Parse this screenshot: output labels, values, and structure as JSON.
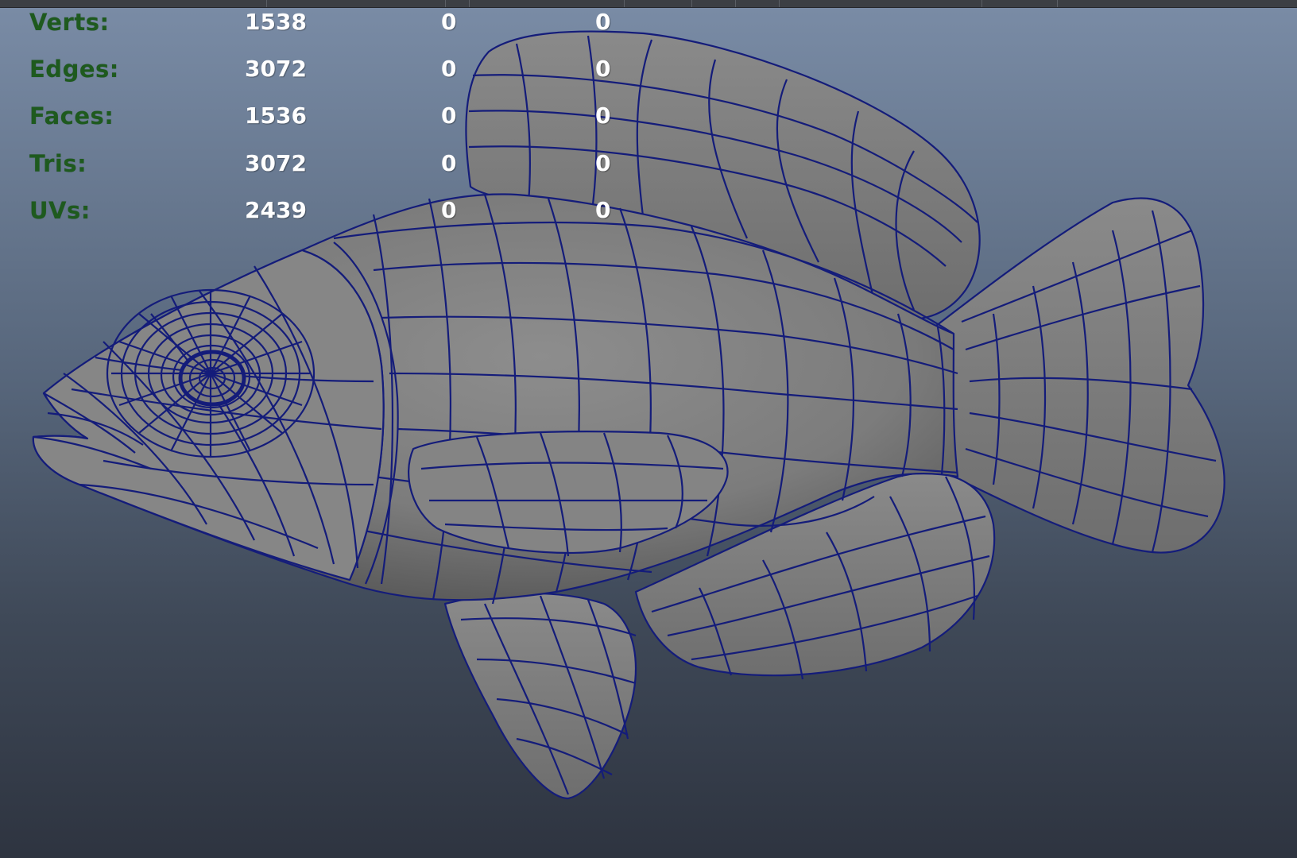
{
  "viewport": {
    "background_top": "#7a8ca6",
    "background_bottom": "#2e3440",
    "wire_color": "#141c7a",
    "shade_color": "#858585"
  },
  "hud": {
    "rows": [
      {
        "label": "Verts:",
        "value": "1538",
        "col2": "0",
        "col3": "0"
      },
      {
        "label": "Edges:",
        "value": "3072",
        "col2": "0",
        "col3": "0"
      },
      {
        "label": "Faces:",
        "value": "1536",
        "col2": "0",
        "col3": "0"
      },
      {
        "label": "Tris:",
        "value": "3072",
        "col2": "0",
        "col3": "0"
      },
      {
        "label": "UVs:",
        "value": "2439",
        "col2": "0",
        "col3": "0"
      }
    ]
  },
  "model": {
    "icon": "fish-mesh-icon"
  }
}
